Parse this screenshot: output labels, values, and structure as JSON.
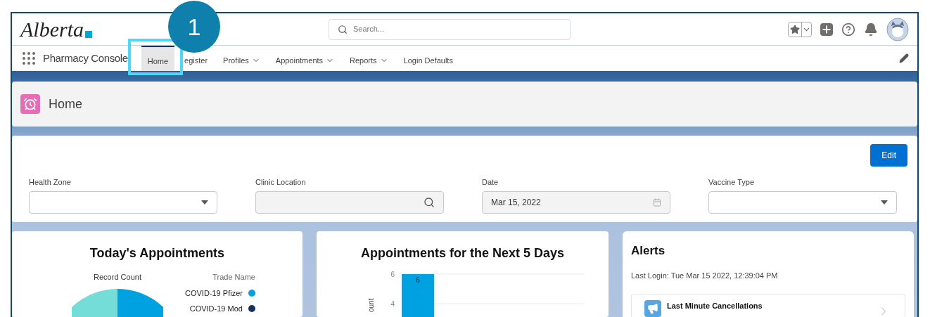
{
  "header": {
    "logo": "Alberta",
    "search": {
      "placeholder": "Search..."
    }
  },
  "callout": {
    "number": "1"
  },
  "nav": {
    "app_name": "Pharmacy Console",
    "tabs": [
      {
        "label": "Home",
        "selected": true,
        "dropdown": false
      },
      {
        "label": "egister",
        "selected": false,
        "dropdown": false
      },
      {
        "label": "Profiles",
        "selected": false,
        "dropdown": true
      },
      {
        "label": "Appointments",
        "selected": false,
        "dropdown": true
      },
      {
        "label": "Reports",
        "selected": false,
        "dropdown": true
      },
      {
        "label": "Login Defaults",
        "selected": false,
        "dropdown": false
      }
    ]
  },
  "page_header": {
    "title": "Home"
  },
  "filters": {
    "edit_button": "Edit",
    "fields": [
      {
        "label": "Health Zone",
        "kind": "select"
      },
      {
        "label": "Clinic Location",
        "kind": "lookup"
      },
      {
        "label": "Date",
        "kind": "date",
        "value": "Mar 15, 2022"
      },
      {
        "label": "Vaccine Type",
        "kind": "select"
      }
    ]
  },
  "todays_appointments": {
    "title": "Today's Appointments",
    "measure_label": "Record Count",
    "legend_title": "Trade Name",
    "legend": [
      {
        "label": "COVID-19 Pfizer",
        "color": "#00a1e0"
      },
      {
        "label": "COVID-19 Mod",
        "color": "#16325c"
      }
    ]
  },
  "next_5_days": {
    "title": "Appointments for the Next 5 Days",
    "chart_data": {
      "type": "bar",
      "ylabel": "ount",
      "values": [
        6
      ],
      "ylim": [
        0,
        6
      ],
      "yticks": [
        4,
        6
      ],
      "data_labels": true
    }
  },
  "alerts": {
    "title": "Alerts",
    "last_login": "Last Login: Tue Mar 15 2022, 12:39:04 PM",
    "items": [
      {
        "title": "Last Minute Cancellations"
      }
    ]
  }
}
